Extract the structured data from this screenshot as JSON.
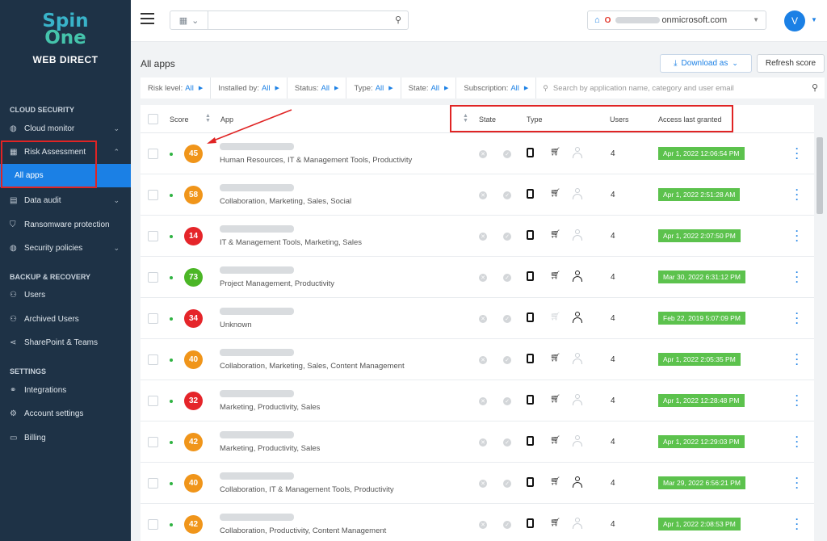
{
  "brand": {
    "logo_line1": "Spin",
    "logo_line2": "One",
    "name": "WEB DIRECT"
  },
  "sidebar": {
    "sections": [
      {
        "label": "CLOUD SECURITY"
      },
      {
        "label": "BACKUP & RECOVERY"
      },
      {
        "label": "SETTINGS"
      }
    ],
    "items": [
      {
        "label": "Cloud monitor",
        "icon": "globe-icon"
      },
      {
        "label": "Risk Assessment",
        "icon": "grid-icon"
      },
      {
        "label": "All apps",
        "icon": ""
      },
      {
        "label": "Data audit",
        "icon": "document-icon"
      },
      {
        "label": "Ransomware protection",
        "icon": "shield-icon"
      },
      {
        "label": "Security policies",
        "icon": "globe-icon"
      },
      {
        "label": "Users",
        "icon": "users-icon"
      },
      {
        "label": "Archived Users",
        "icon": "users-icon"
      },
      {
        "label": "SharePoint & Teams",
        "icon": "share-icon"
      },
      {
        "label": "Integrations",
        "icon": "link-icon"
      },
      {
        "label": "Account settings",
        "icon": "gear-icon"
      },
      {
        "label": "Billing",
        "icon": "billing-icon"
      }
    ]
  },
  "topbar": {
    "tenant_suffix": "onmicrosoft.com",
    "avatar_letter": "V"
  },
  "page": {
    "title": "All apps",
    "download_label": "Download as",
    "refresh_label": "Refresh score"
  },
  "filters": [
    {
      "label": "Risk level:",
      "value": "All"
    },
    {
      "label": "Installed by:",
      "value": "All"
    },
    {
      "label": "Status:",
      "value": "All"
    },
    {
      "label": "Type:",
      "value": "All"
    },
    {
      "label": "State:",
      "value": "All"
    },
    {
      "label": "Subscription:",
      "value": "All"
    }
  ],
  "search_placeholder": "Search by application name, category and user email",
  "columns": {
    "score": "Score",
    "app": "App",
    "state": "State",
    "type": "Type",
    "users": "Users",
    "access": "Access last granted"
  },
  "colors": {
    "accent": "#1b80e5",
    "sidebar": "#1e3246",
    "high_risk": "#e5252a",
    "medium_risk": "#f0951a",
    "low_risk": "#4bb626",
    "granted": "#5cc24d",
    "annotation": "#e02424"
  },
  "rows": [
    {
      "score": "45",
      "risk": "medium",
      "categories": "Human Resources, IT & Management Tools, Productivity",
      "cart": true,
      "user": false,
      "users": "4",
      "date": "Apr 1, 2022 12:06:54 PM"
    },
    {
      "score": "58",
      "risk": "medium",
      "categories": "Collaboration, Marketing, Sales, Social",
      "cart": true,
      "user": false,
      "users": "4",
      "date": "Apr 1, 2022 2:51:28 AM"
    },
    {
      "score": "14",
      "risk": "high",
      "categories": "IT & Management Tools, Marketing, Sales",
      "cart": true,
      "user": false,
      "users": "4",
      "date": "Apr 1, 2022 2:07:50 PM"
    },
    {
      "score": "73",
      "risk": "low",
      "categories": "Project Management, Productivity",
      "cart": true,
      "user": true,
      "users": "4",
      "date": "Mar 30, 2022 6:31:12 PM"
    },
    {
      "score": "34",
      "risk": "high",
      "categories": "Unknown",
      "cart": false,
      "user": true,
      "users": "4",
      "date": "Feb 22, 2019 5:07:09 PM"
    },
    {
      "score": "40",
      "risk": "medium",
      "categories": "Collaboration, Marketing, Sales, Content Management",
      "cart": true,
      "user": false,
      "users": "4",
      "date": "Apr 1, 2022 2:05:35 PM"
    },
    {
      "score": "32",
      "risk": "high",
      "categories": "Marketing, Productivity, Sales",
      "cart": true,
      "user": false,
      "users": "4",
      "date": "Apr 1, 2022 12:28:48 PM"
    },
    {
      "score": "42",
      "risk": "medium",
      "categories": "Marketing, Productivity, Sales",
      "cart": true,
      "user": false,
      "users": "4",
      "date": "Apr 1, 2022 12:29:03 PM"
    },
    {
      "score": "40",
      "risk": "medium",
      "categories": "Collaboration, IT & Management Tools, Productivity",
      "cart": true,
      "user": true,
      "users": "4",
      "date": "Mar 29, 2022 6:56:21 PM"
    },
    {
      "score": "42",
      "risk": "medium",
      "categories": "Collaboration, Productivity, Content Management",
      "cart": true,
      "user": false,
      "users": "4",
      "date": "Apr 1, 2022 2:08:53 PM"
    }
  ]
}
